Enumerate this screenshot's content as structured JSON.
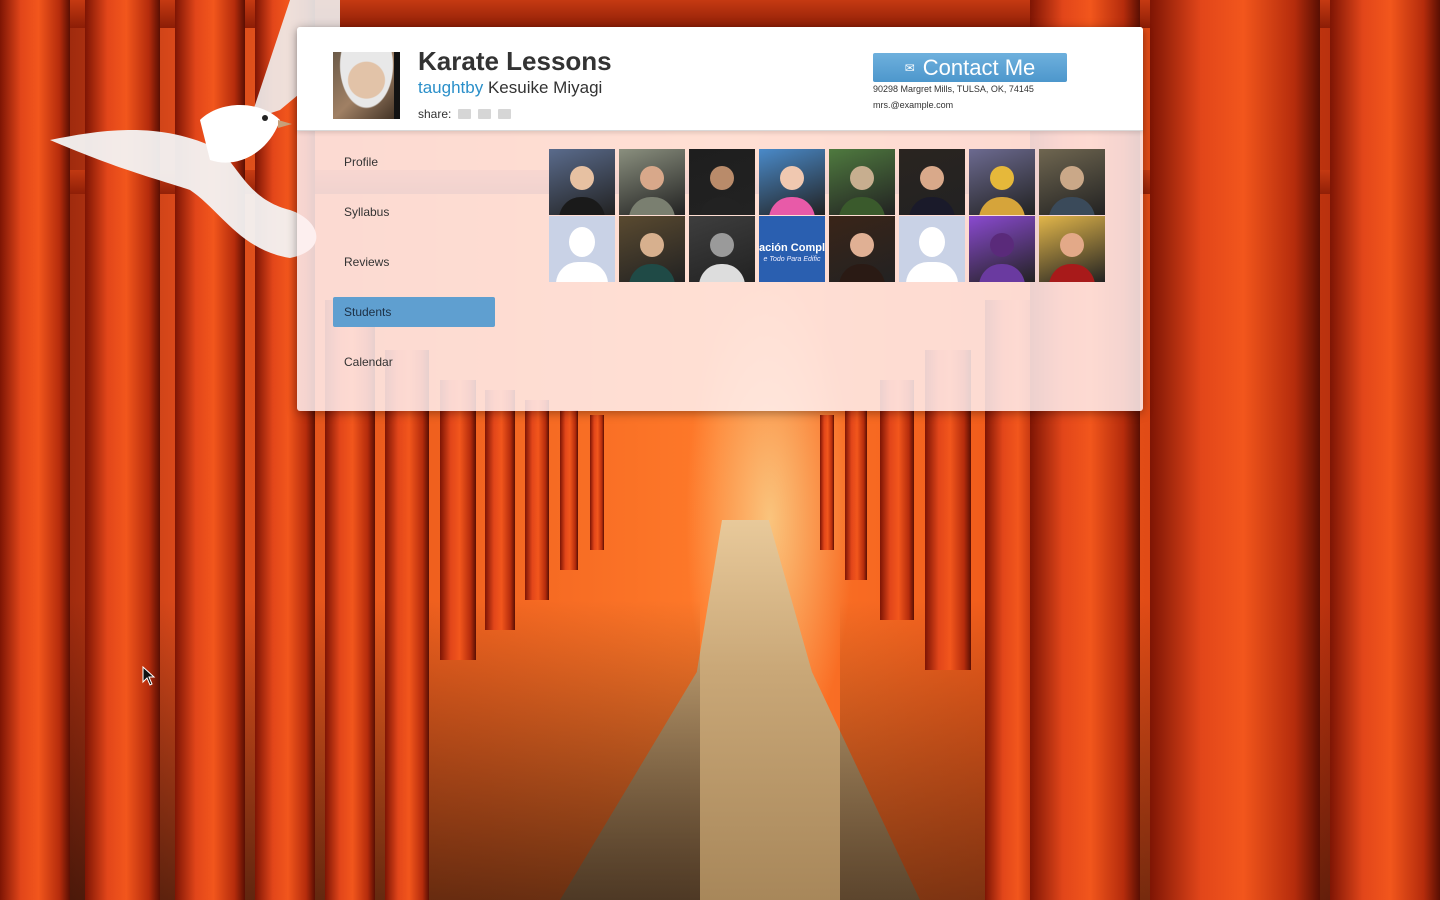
{
  "course": {
    "title": "Karate Lessons",
    "taught_by_label": "taughtby",
    "instructor": "Kesuike Miyagi",
    "share_label": "share:",
    "share_buttons": [
      "share-1",
      "share-2",
      "share-3"
    ]
  },
  "contact": {
    "button_label": "Contact Me",
    "icon": "mail-icon",
    "address": "90298 Margret Mills, TULSA, OK, 74145",
    "email": "mrs.@example.com"
  },
  "nav": {
    "items": [
      {
        "label": "Profile",
        "active": false
      },
      {
        "label": "Syllabus",
        "active": false
      },
      {
        "label": "Reviews",
        "active": false
      },
      {
        "label": "Students",
        "active": true
      },
      {
        "label": "Calendar",
        "active": false
      }
    ]
  },
  "students": {
    "tiles": [
      {
        "kind": "photo",
        "bg": "#5a6b8c",
        "skin": "#e7c1a2",
        "shirt": "#1a1a1a"
      },
      {
        "kind": "photo",
        "bg": "#8a8f7e",
        "skin": "#d8a88a",
        "shirt": "#7a7f70"
      },
      {
        "kind": "photo",
        "bg": "#1e1e1e",
        "skin": "#b98b6a",
        "shirt": "#222222"
      },
      {
        "kind": "photo",
        "bg": "#4a8ac9",
        "skin": "#f0c8b0",
        "shirt": "#e85aa8"
      },
      {
        "kind": "photo",
        "bg": "#4f7a3f",
        "skin": "#c7ae8f",
        "shirt": "#3a5a2c"
      },
      {
        "kind": "photo",
        "bg": "#2a2420",
        "skin": "#d9a98a",
        "shirt": "#1a1a2a"
      },
      {
        "kind": "photo",
        "bg": "#6c6a90",
        "skin": "#e6b83a",
        "shirt": "#d6a43a"
      },
      {
        "kind": "photo",
        "bg": "#6f6650",
        "skin": "#caa888",
        "shirt": "#3a4a5a"
      },
      {
        "kind": "placeholder"
      },
      {
        "kind": "photo",
        "bg": "#5a4a30",
        "skin": "#d7b08e",
        "shirt": "#1f4a46"
      },
      {
        "kind": "photo",
        "bg": "#3e3e3e",
        "skin": "#9a9a9a",
        "shirt": "#dddddd"
      },
      {
        "kind": "text",
        "bg": "#2a5fb0",
        "text": "ación Complet",
        "subtext": "e Todo Para Edific"
      },
      {
        "kind": "photo",
        "bg": "#3a2418",
        "skin": "#e0b094",
        "shirt": "#2a1a14"
      },
      {
        "kind": "placeholder"
      },
      {
        "kind": "photo",
        "bg": "#8a4ad0",
        "skin": "#5a2a7a",
        "shirt": "#6a3aa0"
      },
      {
        "kind": "photo",
        "bg": "#e2b64a",
        "skin": "#e3a988",
        "shirt": "#a81a1a"
      }
    ]
  },
  "colors": {
    "accent": "#5f9fd0",
    "link": "#2a8fc9",
    "button": "#4d97cc"
  }
}
